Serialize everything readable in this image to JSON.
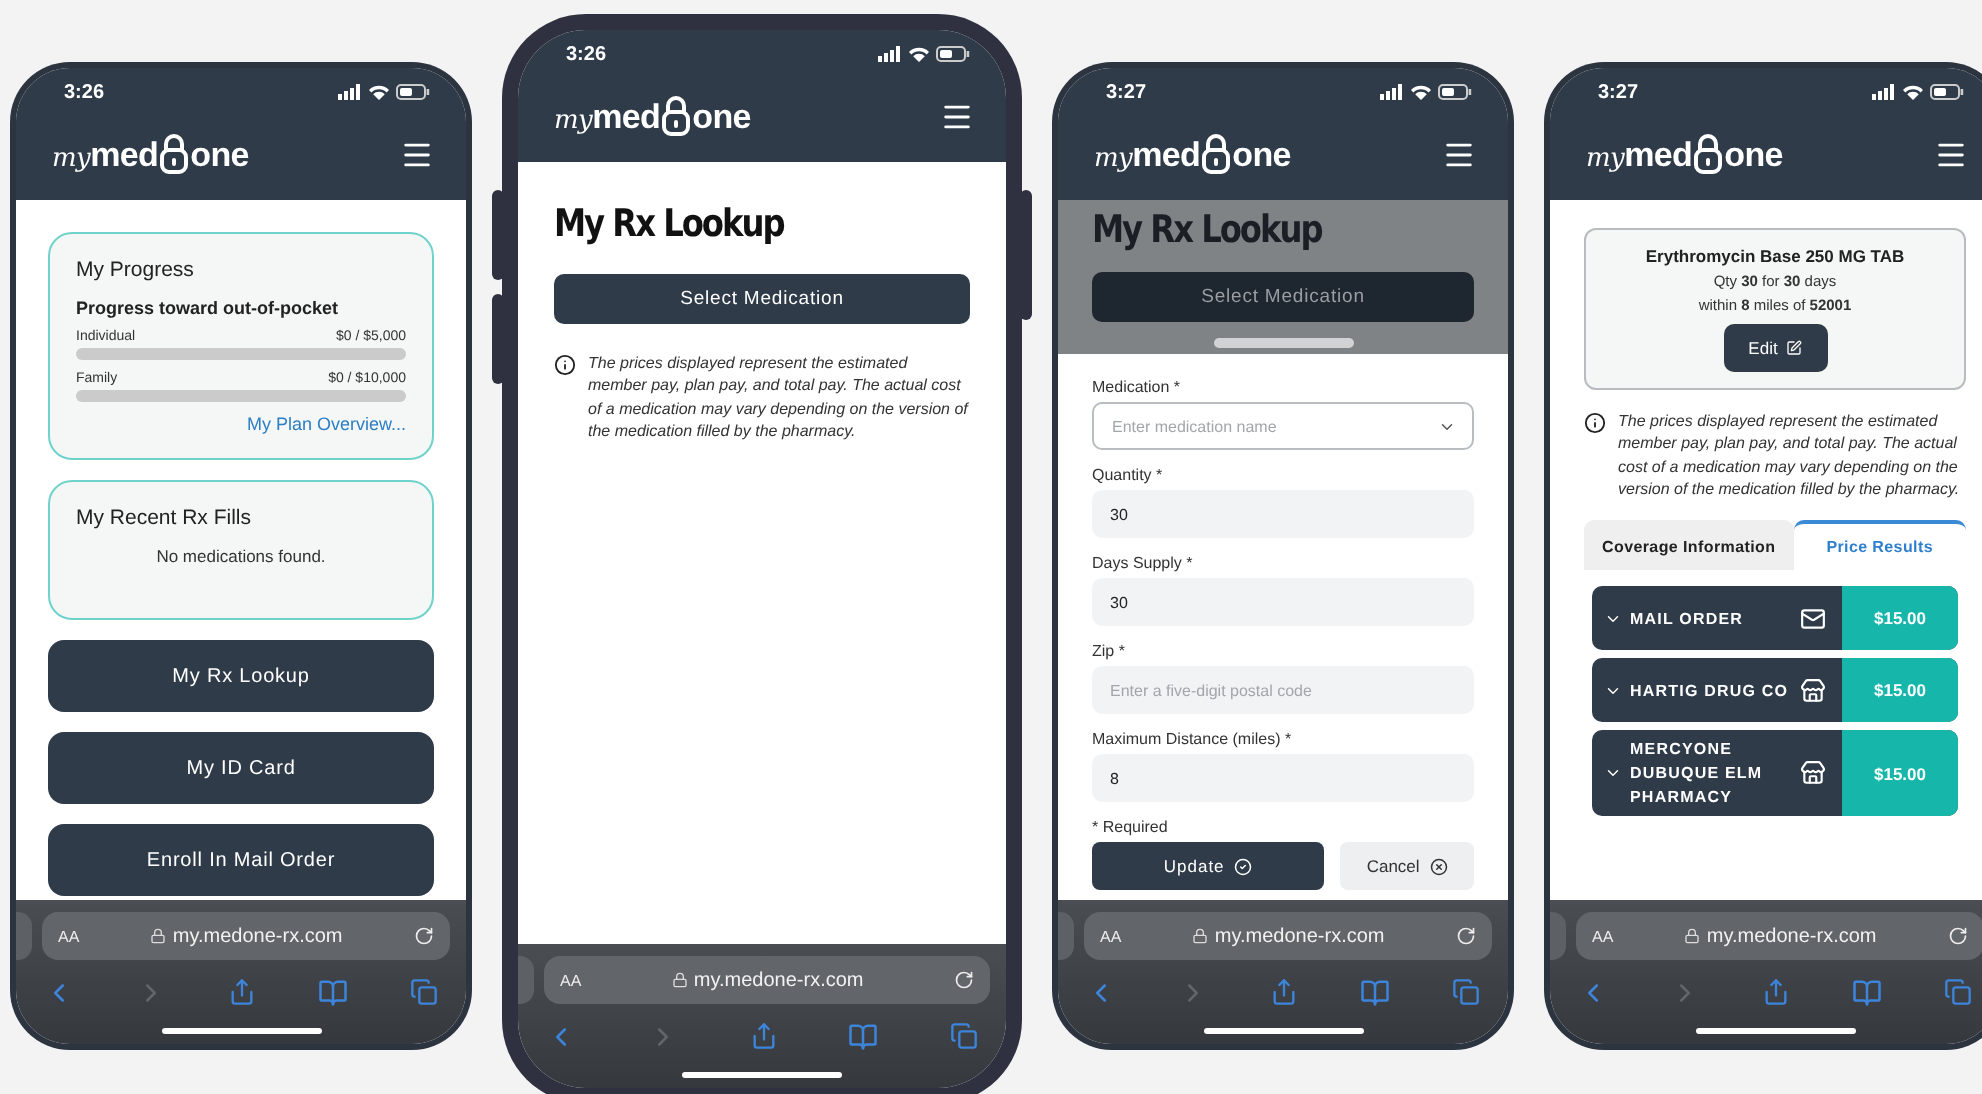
{
  "phones": [
    {
      "kind": "dashboard",
      "time": "3:26",
      "logo": {
        "script": "my",
        "word_1": "med",
        "word_2": "one"
      },
      "progress_card": {
        "title": "My Progress",
        "subtitle": "Progress toward out-of-pocket",
        "meters": [
          {
            "label": "Individual",
            "reading": "$0 / $5,000",
            "level": 0
          },
          {
            "label": "Family",
            "reading": "$0 / $10,000",
            "level": 0
          }
        ],
        "link": "My Plan Overview..."
      },
      "recent_card": {
        "title": "My Recent Rx Fills",
        "message": "No medications found."
      },
      "buttons": [
        "My Rx Lookup",
        "My ID Card",
        "Enroll In Mail Order"
      ],
      "browser": {
        "text_size": "AA",
        "url": "my.medone-rx.com"
      }
    },
    {
      "kind": "lookup",
      "time": "3:26",
      "logo": {
        "script": "my",
        "word_1": "med",
        "word_2": "one"
      },
      "heading": "My Rx Lookup",
      "button": "Select Medication",
      "notice": "The prices displayed represent the estimated member pay, plan pay, and total pay. The actual cost of a medication may vary depending on the version of the medication filled by the pharmacy.",
      "browser": {
        "text_size": "AA",
        "url": "my.medone-rx.com"
      }
    },
    {
      "kind": "form",
      "time": "3:27",
      "logo": {
        "script": "my",
        "word_1": "med",
        "word_2": "one"
      },
      "background": {
        "heading": "My Rx Lookup",
        "button": "Select Medication"
      },
      "fields": [
        {
          "kind": "select",
          "label": "Medication *",
          "placeholder": "Enter medication name"
        },
        {
          "kind": "text",
          "label": "Quantity *",
          "value": "30"
        },
        {
          "kind": "text",
          "label": "Days Supply *",
          "value": "30"
        },
        {
          "kind": "text",
          "label": "Zip *",
          "placeholder": "Enter a five-digit postal code"
        },
        {
          "kind": "text",
          "label": "Maximum Distance (miles) *",
          "value": "8"
        }
      ],
      "required_note": "* Required",
      "buttons": [
        {
          "kind": "primary",
          "label": "Update"
        },
        {
          "kind": "secondary",
          "label": "Cancel"
        }
      ],
      "browser": {
        "text_size": "AA",
        "url": "my.medone-rx.com"
      }
    },
    {
      "kind": "results",
      "time": "3:27",
      "logo": {
        "script": "my",
        "word_1": "med",
        "word_2": "one"
      },
      "summary": {
        "title": "Erythromycin Base 250 MG TAB",
        "lines": [
          "Qty **30** for **30** days",
          "within **8** miles of **52001**"
        ],
        "button": "Edit"
      },
      "notice": "The prices displayed represent the estimated member pay, plan pay, and total pay. The actual cost of a medication may vary depending on the version of the medication filled by the pharmacy.",
      "tabs": [
        {
          "label": "Coverage Information",
          "selected": false
        },
        {
          "label": "Price Results",
          "selected": true
        }
      ],
      "results": [
        {
          "kind": "mail",
          "name": "MAIL ORDER",
          "price": "$15.00"
        },
        {
          "kind": "store",
          "name": "HARTIG DRUG CO",
          "price": "$15.00"
        },
        {
          "kind": "store",
          "name": "MERCYONE DUBUQUE ELM PHARMACY",
          "price": "$15.00"
        }
      ],
      "browser": {
        "text_size": "AA",
        "url": "my.medone-rx.com"
      }
    }
  ]
}
